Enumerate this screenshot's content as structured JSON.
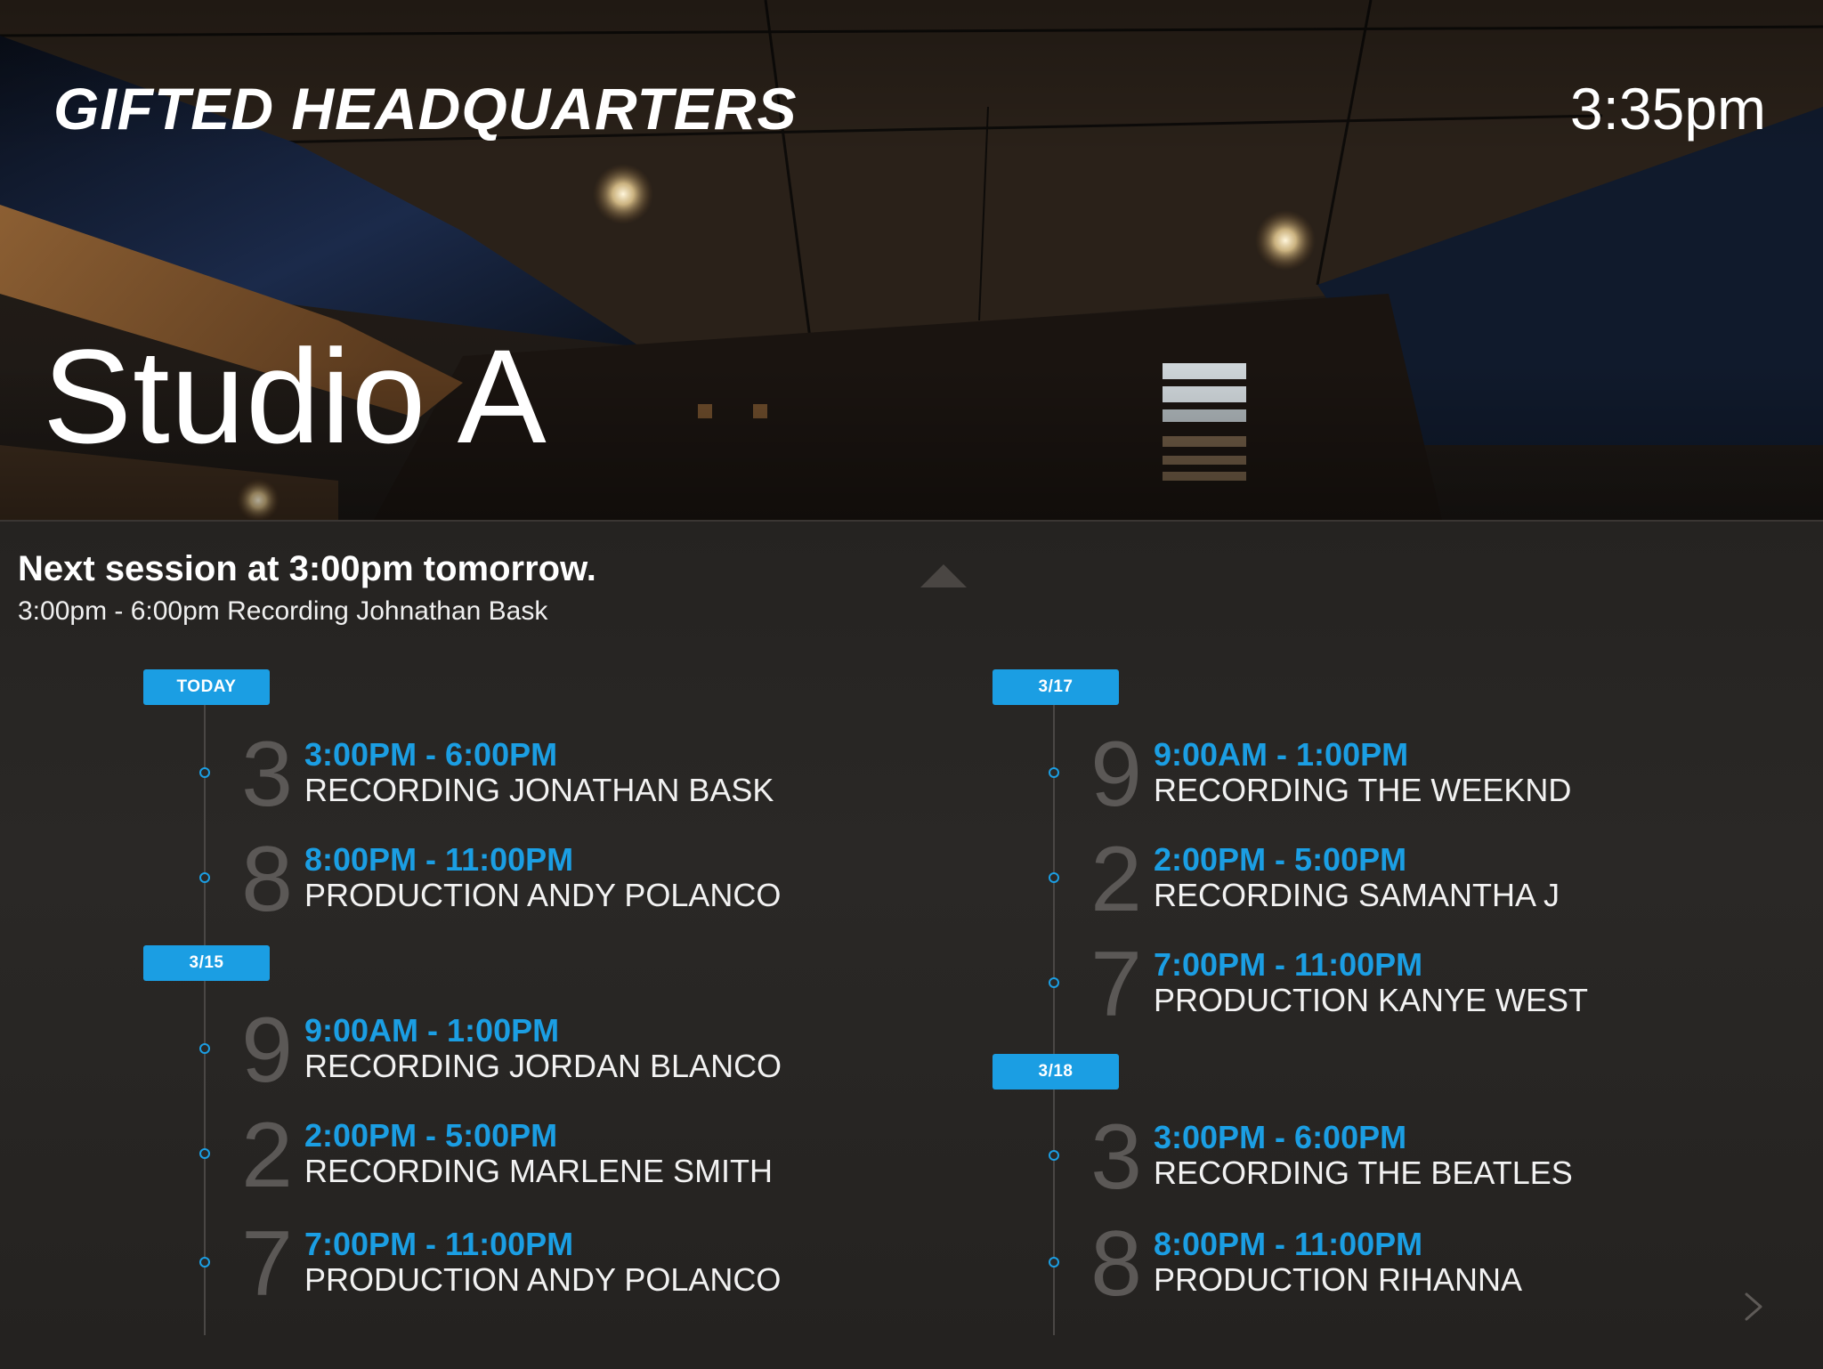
{
  "header": {
    "brand": "GIFTED HEADQUARTERS",
    "time": "3:35pm",
    "room": "Studio A"
  },
  "next_session": {
    "headline": "Next session at 3:00pm tomorrow.",
    "detail": "3:00pm - 6:00pm Recording Johnathan Bask"
  },
  "colors": {
    "accent": "#1b9ee3",
    "numeral": "#5b5856",
    "panel": "#2a2826"
  },
  "icons": {
    "collapse": "triangle-up-icon",
    "next": "chevron-right-icon"
  },
  "schedule": [
    {
      "date": "TODAY",
      "events": [
        {
          "numeral": "3",
          "time": "3:00PM - 6:00PM",
          "title": "RECORDING JONATHAN BASK"
        },
        {
          "numeral": "8",
          "time": "8:00PM - 11:00PM",
          "title": "PRODUCTION ANDY POLANCO"
        }
      ]
    },
    {
      "date": "3/15",
      "events": [
        {
          "numeral": "9",
          "time": "9:00AM - 1:00PM",
          "title": "RECORDING JORDAN BLANCO"
        },
        {
          "numeral": "2",
          "time": "2:00PM - 5:00PM",
          "title": "RECORDING MARLENE SMITH"
        },
        {
          "numeral": "7",
          "time": "7:00PM - 11:00PM",
          "title": "PRODUCTION ANDY POLANCO"
        }
      ]
    },
    {
      "date": "3/17",
      "events": [
        {
          "numeral": "9",
          "time": "9:00AM - 1:00PM",
          "title": "RECORDING THE WEEKND"
        },
        {
          "numeral": "2",
          "time": "2:00PM - 5:00PM",
          "title": "RECORDING SAMANTHA J"
        },
        {
          "numeral": "7",
          "time": "7:00PM - 11:00PM",
          "title": "PRODUCTION KANYE WEST"
        }
      ]
    },
    {
      "date": "3/18",
      "events": [
        {
          "numeral": "3",
          "time": "3:00PM - 6:00PM",
          "title": "RECORDING THE BEATLES"
        },
        {
          "numeral": "8",
          "time": "8:00PM - 11:00PM",
          "title": "PRODUCTION RIHANNA"
        }
      ]
    }
  ]
}
